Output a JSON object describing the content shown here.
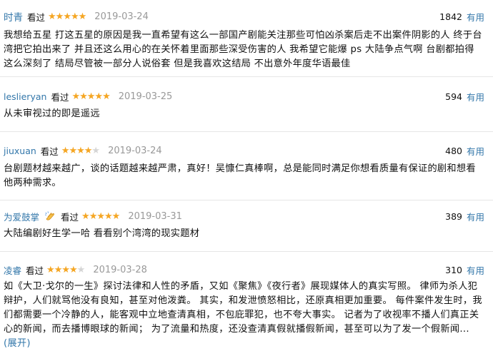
{
  "reviews": [
    {
      "user": "时青",
      "watched": "看过",
      "rating": 5,
      "date": "2019-03-24",
      "votes": "1842",
      "useful_label": "有用",
      "text": "我想给五星 打这五星的原因是我一直希望有这么一部国产剧能关注那些可怕凶杀案后走不出案件阴影的人 终于台湾把它拍出来了 并且还这么用心的在关怀着里面那些深受伤害的人 我希望它能爆 ps 大陆争点气啊 台剧都拍得这么深刻了 结局尽管被一部分人说俗套 但是我喜欢这结局 不出意外年度华语最佳"
    },
    {
      "user": "leslieryan",
      "watched": "看过",
      "rating": 5,
      "date": "2019-03-25",
      "votes": "594",
      "useful_label": "有用",
      "text": "从未审视过的即是遥远"
    },
    {
      "user": "jiuxuan",
      "watched": "看过",
      "rating": 4,
      "date": "2019-03-24",
      "votes": "480",
      "useful_label": "有用",
      "text": "台剧题材越来越广，谈的话题越来越严肃，真好！吴慷仁真棒啊，总是能同时满足你想看质量有保证的剧和想看他两种需求。"
    },
    {
      "user": "为爱鼓掌",
      "watched": "看过",
      "rating": 5,
      "date": "2019-03-31",
      "votes": "389",
      "useful_label": "有用",
      "text": "大陆编剧好生学一哈 看看别个湾湾的现实题材"
    },
    {
      "user": "凌睿",
      "watched": "看过",
      "rating": 4,
      "date": "2019-03-28",
      "votes": "310",
      "useful_label": "有用",
      "text": "如《大卫·戈尔的一生》探讨法律和人性的矛盾，又如《聚焦》《夜行者》展现媒体人的真实写照。 律师为杀人犯辩护，人们就骂他没有良知，甚至对他泼粪。 其实，和发泄愤怒相比，还原真相更加重要。 每件案件发生时，我们都需要一个冷静的人，能客观中立地查清真相，不包庇罪犯，也不夸大事实。 记者为了收视率不播人们真正关心的新闻，而去播博眼球的新闻； 为了流量和热度，还没查清真假就播假新闻，甚至可以为了发一个假新闻...",
      "expand_label": "(展开)"
    }
  ]
}
